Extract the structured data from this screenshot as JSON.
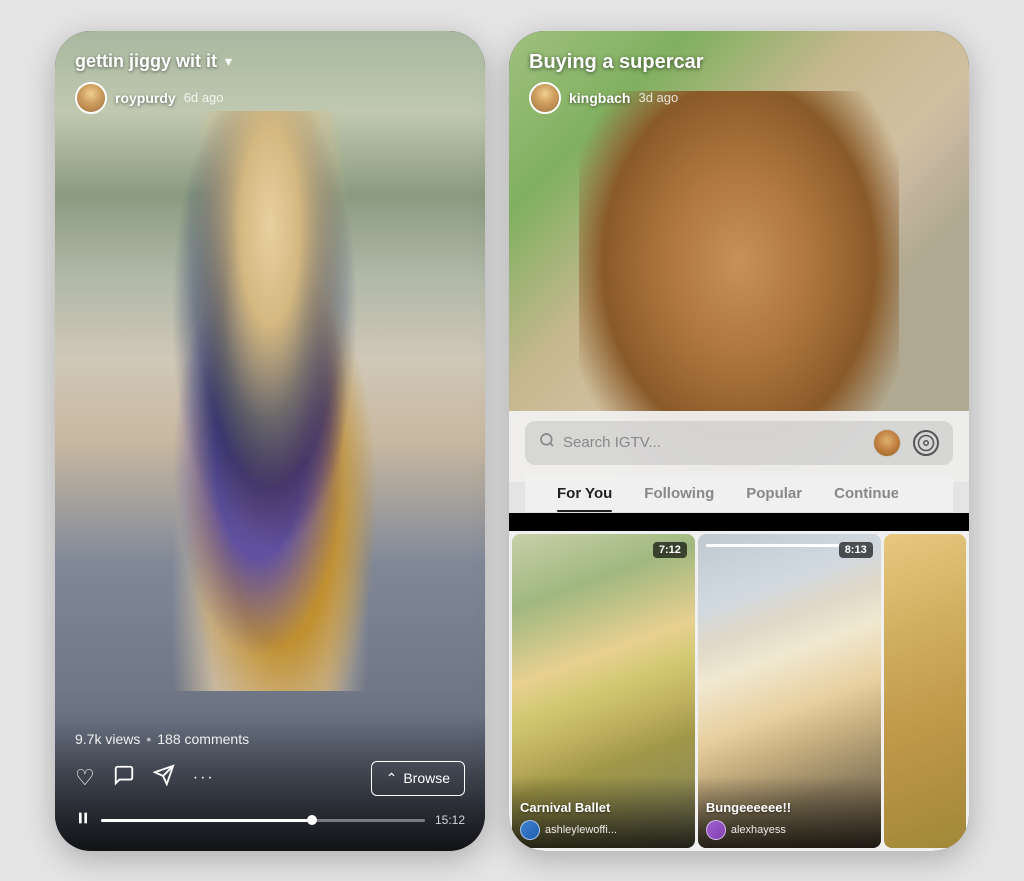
{
  "left_phone": {
    "video_title": "gettin jiggy wit it",
    "dropdown_label": "▾",
    "username": "roypurdy",
    "time_ago": "6d ago",
    "stats": {
      "views": "9.7k views",
      "separator": "•",
      "comments": "188 comments"
    },
    "actions": {
      "like_icon": "♡",
      "comment_icon": "💬",
      "send_icon": "✈",
      "more_icon": "•••",
      "browse_label": "Browse",
      "browse_arrow": "⌃"
    },
    "playback": {
      "pause_icon": "⏸",
      "duration": "15:12"
    }
  },
  "right_phone": {
    "video_title": "Buying a supercar",
    "username": "kingbach",
    "time_ago": "3d ago",
    "search": {
      "placeholder": "Search IGTV...",
      "search_icon": "🔍"
    },
    "tabs": [
      {
        "label": "For You",
        "active": true
      },
      {
        "label": "Following",
        "active": false
      },
      {
        "label": "Popular",
        "active": false
      },
      {
        "label": "Continue W",
        "active": false
      }
    ],
    "thumbnails": [
      {
        "title": "Carnival Ballet",
        "username": "ashleylewoffi...",
        "duration": "7:12",
        "progress_pct": 0
      },
      {
        "title": "Bungeeeeee!!",
        "username": "alexhayess",
        "duration": "8:13",
        "progress_pct": 80
      },
      {
        "title": "",
        "username": "",
        "duration": "",
        "progress_pct": 0
      }
    ]
  }
}
